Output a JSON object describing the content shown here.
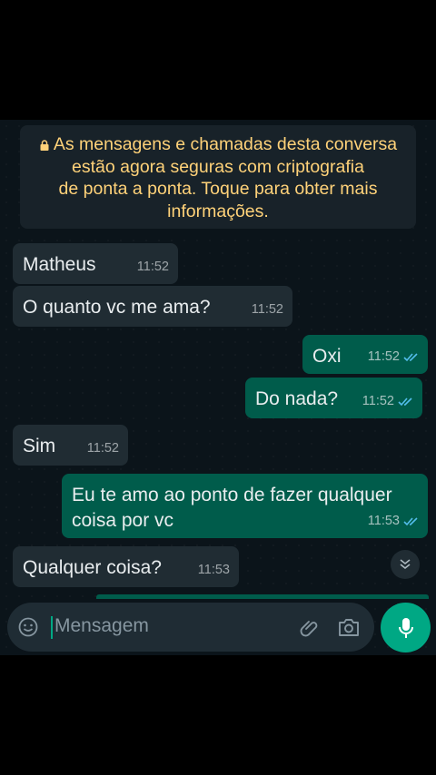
{
  "encryption_notice": {
    "lines": [
      "As mensagens e chamadas desta conversa",
      "estão agora seguras com criptografia",
      "de ponta a ponta. Toque para obter mais",
      "informações."
    ]
  },
  "messages": [
    {
      "direction": "in",
      "text": "Matheus",
      "time": "11:52"
    },
    {
      "direction": "in",
      "text": "O quanto vc me ama?",
      "time": "11:52"
    },
    {
      "direction": "out",
      "text": "Oxi",
      "time": "11:52",
      "status": "read"
    },
    {
      "direction": "out",
      "text": "Do nada?",
      "time": "11:52",
      "status": "read"
    },
    {
      "direction": "in",
      "text": "Sim",
      "time": "11:52"
    },
    {
      "direction": "out",
      "lines": [
        "Eu te amo ao ponto de fazer qualquer",
        "coisa por vc"
      ],
      "time": "11:53",
      "status": "read"
    },
    {
      "direction": "in",
      "text": "Qualquer coisa?",
      "time": "11:53"
    }
  ],
  "composer": {
    "placeholder": "Mensagem",
    "icons": [
      "emoji-icon",
      "attach-icon",
      "camera-icon",
      "mic-icon"
    ]
  },
  "colors": {
    "background": "#0b141a",
    "incoming_bubble": "#202c33",
    "outgoing_bubble": "#005c4b",
    "notice_text": "#ffd279",
    "accent": "#00a884",
    "read_tick": "#53bdeb"
  }
}
